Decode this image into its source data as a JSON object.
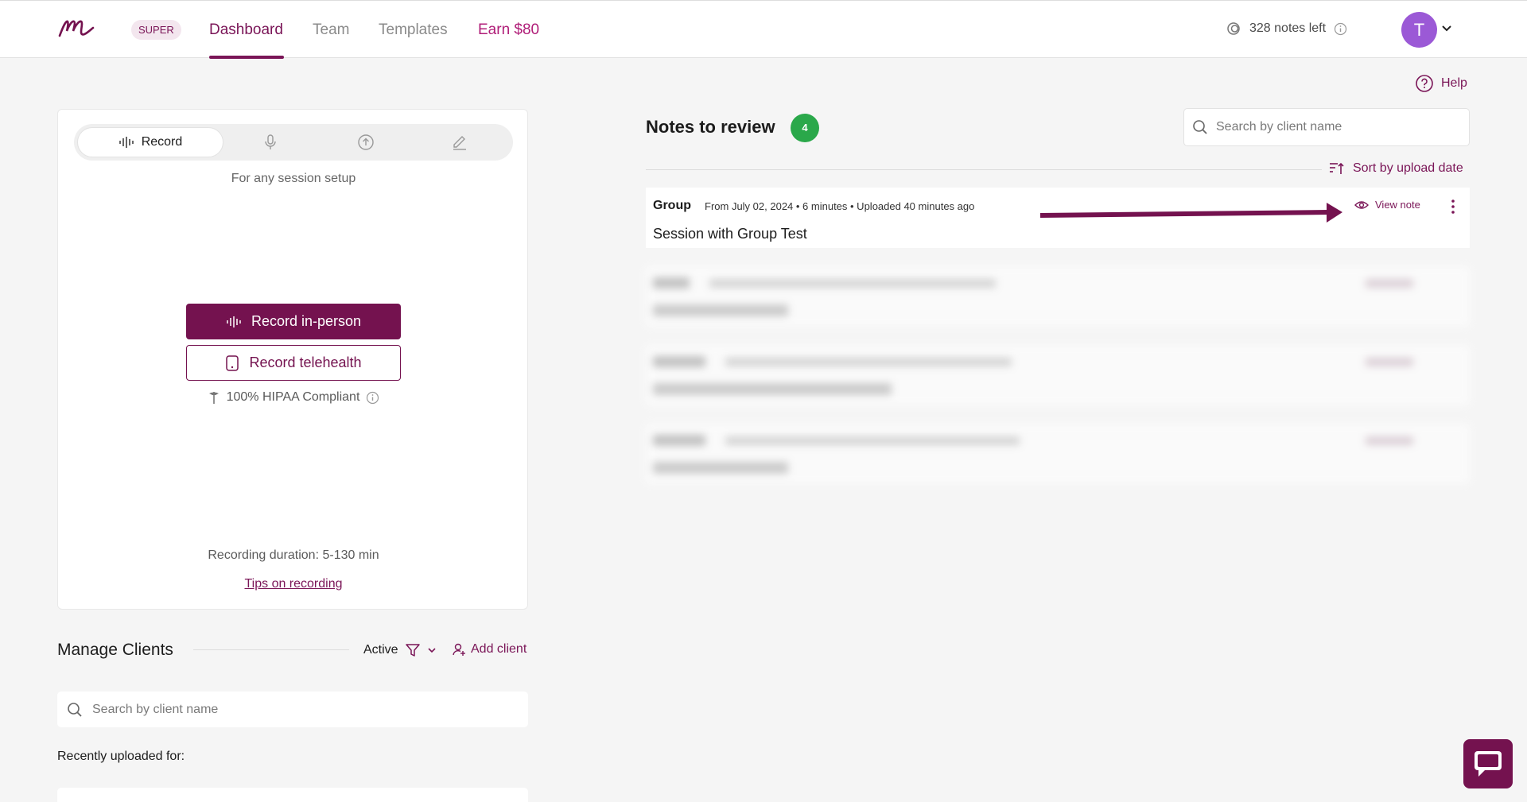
{
  "header": {
    "plan_badge": "SUPER",
    "tabs": [
      {
        "label": "Dashboard",
        "active": true
      },
      {
        "label": "Team"
      },
      {
        "label": "Templates"
      },
      {
        "label": "Earn $80"
      }
    ],
    "credits_label": "328 notes left",
    "avatar_initial": "T"
  },
  "help_label": "Help",
  "record_card": {
    "active_mode_label": "Record",
    "mode_icons": [
      "waveform-icon",
      "microphone-icon",
      "upload-icon",
      "pencil-icon"
    ],
    "subtitle": "For any session setup",
    "primary_button": "Record in-person",
    "secondary_button": "Record telehealth",
    "hipaa_label": "100% HIPAA Compliant",
    "duration_label": "Recording duration: 5-130 min",
    "tips_link": "Tips on recording"
  },
  "manage_clients": {
    "title": "Manage Clients",
    "filter_label": "Active",
    "add_client_label": "Add client",
    "search_placeholder": "Search by client name",
    "recent_label": "Recently uploaded for:"
  },
  "notes": {
    "title": "Notes to review",
    "count": "4",
    "search_placeholder": "Search by client name",
    "sort_label": "Sort by upload date",
    "items": [
      {
        "type": "Group",
        "meta": "From July 02, 2024 • 6 minutes • Uploaded 40 minutes ago",
        "title": "Session with Group Test",
        "action": "View note"
      }
    ]
  },
  "colors": {
    "brand": "#74124f",
    "accent_text": "#7a1557",
    "badge_green": "#2aa84a",
    "avatar": "#9b59d6"
  }
}
